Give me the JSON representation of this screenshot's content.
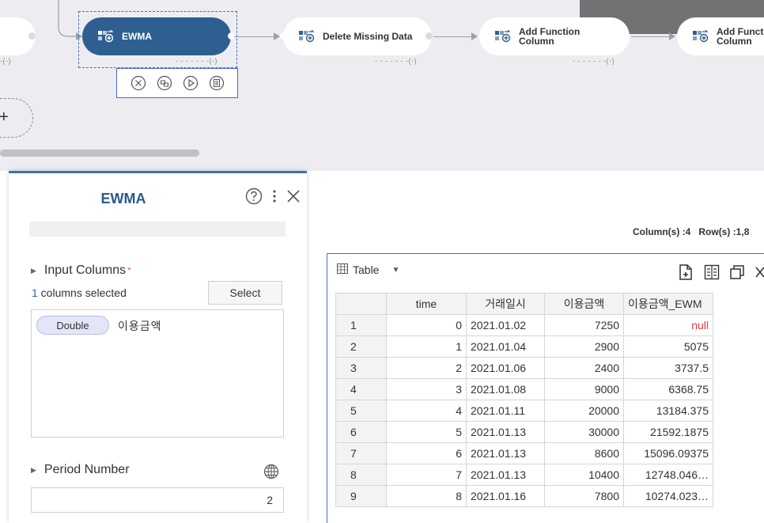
{
  "pipeline": {
    "nodes": [
      {
        "label": "EWMA",
        "meta": "- - - - - - -(-)",
        "icon": "function-node-icon",
        "active": true
      },
      {
        "label": "Delete Missing Data",
        "meta": "- - - - - - -(-)",
        "icon": "function-node-icon"
      },
      {
        "label": "Add Function\nColumn",
        "meta": "- - - - - - -(-)",
        "icon": "function-node-icon"
      },
      {
        "label": "Add Funct\nColumn",
        "icon": "function-node-icon"
      }
    ],
    "left_node_meta": "-(-)",
    "add_node_symbol": "+",
    "toolbox_icons": [
      "delete-icon",
      "copy-node-icon",
      "run-icon",
      "log-icon"
    ]
  },
  "panel": {
    "title": "EWMA",
    "input_columns": {
      "title": "Input Columns",
      "required_mark": "*",
      "selected_count": "1",
      "selected_suffix": " columns selected",
      "select_button": "Select",
      "columns": [
        {
          "type": "Double",
          "name": "이용금액"
        }
      ]
    },
    "period_number": {
      "title": "Period Number",
      "value": "2"
    }
  },
  "table": {
    "summary_columns": "Column(s) :4",
    "summary_rows": "Row(s) :1,8",
    "view_label": "Table",
    "columns": [
      "time",
      "거래일시",
      "이용금액",
      "이용금액_EWM"
    ],
    "rows": [
      {
        "idx": "1",
        "time": "0",
        "date": "2021.01.02",
        "amount": "7250",
        "ewma": "null"
      },
      {
        "idx": "2",
        "time": "1",
        "date": "2021.01.04",
        "amount": "2900",
        "ewma": "5075"
      },
      {
        "idx": "3",
        "time": "2",
        "date": "2021.01.06",
        "amount": "2400",
        "ewma": "3737.5"
      },
      {
        "idx": "4",
        "time": "3",
        "date": "2021.01.08",
        "amount": "9000",
        "ewma": "6368.75"
      },
      {
        "idx": "5",
        "time": "4",
        "date": "2021.01.11",
        "amount": "20000",
        "ewma": "13184.375"
      },
      {
        "idx": "6",
        "time": "5",
        "date": "2021.01.13",
        "amount": "30000",
        "ewma": "21592.1875"
      },
      {
        "idx": "7",
        "time": "6",
        "date": "2021.01.13",
        "amount": "8600",
        "ewma": "15096.09375"
      },
      {
        "idx": "8",
        "time": "7",
        "date": "2021.01.13",
        "amount": "10400",
        "ewma": "12748.046…"
      },
      {
        "idx": "9",
        "time": "8",
        "date": "2021.01.16",
        "amount": "7800",
        "ewma": "10274.023…"
      }
    ]
  },
  "colors": {
    "accent": "#2f5f91",
    "title": "#2b5a8a",
    "null_value": "#e23b3b",
    "selection": "#4a68c4"
  }
}
